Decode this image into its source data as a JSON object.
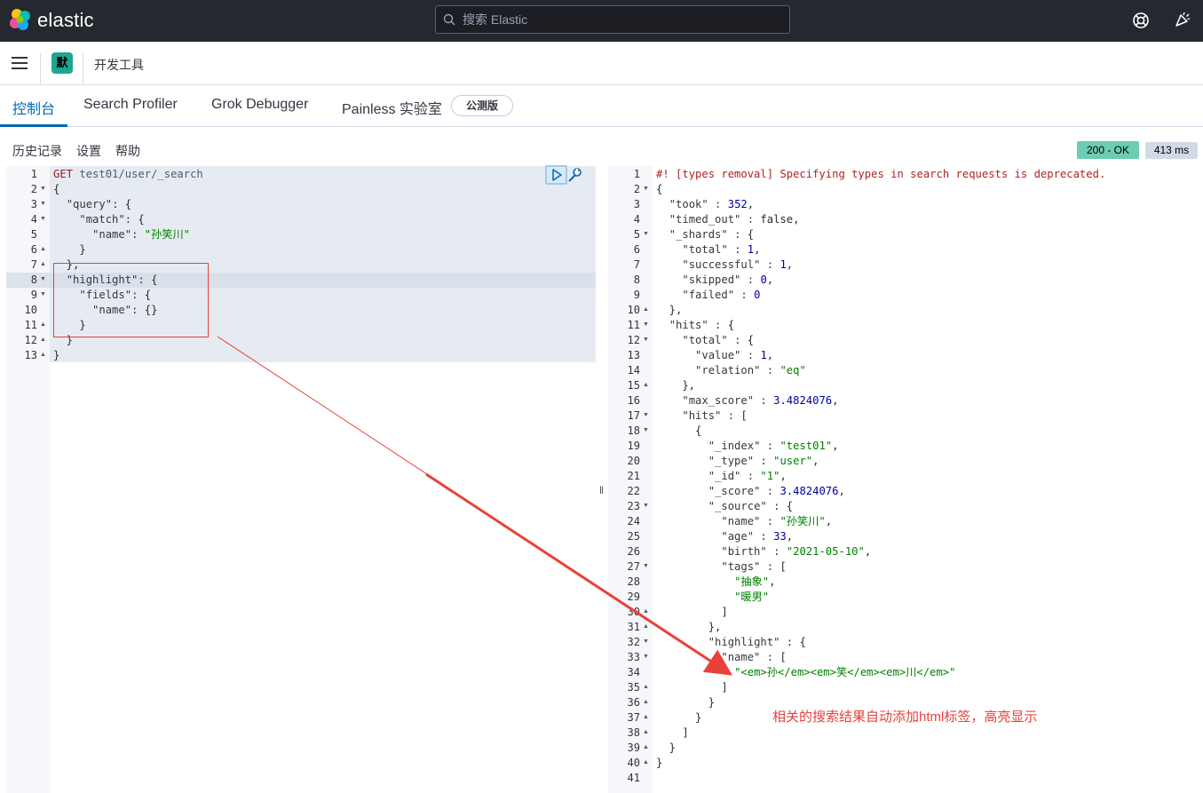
{
  "topbar": {
    "brand": "elastic",
    "search_placeholder": "搜索 Elastic",
    "help_icon": "help-lifebuoy-icon",
    "news_icon": "newsfeed-icon"
  },
  "navbar": {
    "space_initial": "默",
    "breadcrumb": "开发工具"
  },
  "tabs": [
    {
      "label": "控制台",
      "active": true
    },
    {
      "label": "Search Profiler"
    },
    {
      "label": "Grok Debugger"
    },
    {
      "label": "Painless 实验室"
    }
  ],
  "beta_badge": "公测版",
  "console_menu": [
    "历史记录",
    "设置",
    "帮助"
  ],
  "status": {
    "code": "200 - OK",
    "time": "413 ms"
  },
  "request_lines": [
    "GET test01/user/_search",
    "{",
    "  \"query\": {",
    "    \"match\": {",
    "      \"name\": \"孙笑川\"",
    "    }",
    "  },",
    "  \"highlight\": {",
    "    \"fields\": {",
    "      \"name\": {}",
    "    }",
    "  }",
    "}"
  ],
  "response_lines": [
    "#! [types removal] Specifying types in search requests is deprecated.",
    "{",
    "  \"took\" : 352,",
    "  \"timed_out\" : false,",
    "  \"_shards\" : {",
    "    \"total\" : 1,",
    "    \"successful\" : 1,",
    "    \"skipped\" : 0,",
    "    \"failed\" : 0",
    "  },",
    "  \"hits\" : {",
    "    \"total\" : {",
    "      \"value\" : 1,",
    "      \"relation\" : \"eq\"",
    "    },",
    "    \"max_score\" : 3.4824076,",
    "    \"hits\" : [",
    "      {",
    "        \"_index\" : \"test01\",",
    "        \"_type\" : \"user\",",
    "        \"_id\" : \"1\",",
    "        \"_score\" : 3.4824076,",
    "        \"_source\" : {",
    "          \"name\" : \"孙笑川\",",
    "          \"age\" : 33,",
    "          \"birth\" : \"2021-05-10\",",
    "          \"tags\" : [",
    "            \"抽象\",",
    "            \"暖男\"",
    "          ]",
    "        },",
    "        \"highlight\" : {",
    "          \"name\" : [",
    "            \"<em>孙</em><em>笑</em><em>川</em>\"",
    "          ]",
    "        }",
    "      }",
    "    ]",
    "  }",
    "}",
    ""
  ],
  "annotation_note": "相关的搜索结果自动添加html标签，高亮显示",
  "colors": {
    "accent": "#006bb4",
    "annotation": "#e8413b",
    "success": "#6dccb1"
  }
}
